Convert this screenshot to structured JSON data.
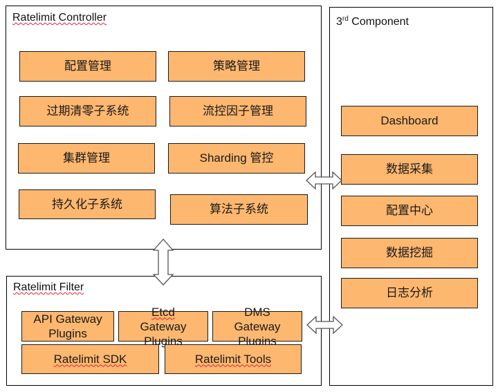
{
  "controller": {
    "title": "Ratelimit Controller",
    "modules": [
      "配置管理",
      "策略管理",
      "过期清零子系统",
      "流控因子管理",
      "集群管理",
      "Sharding 管控",
      "持久化子系统",
      "算法子系统"
    ]
  },
  "third_party": {
    "title_prefix": "3",
    "title_sup": "rd",
    "title_suffix": " Component",
    "modules": [
      "Dashboard",
      "数据采集",
      "配置中心",
      "数据挖掘",
      "日志分析"
    ]
  },
  "filter": {
    "title": "Ratelimit Filter",
    "plugins": [
      [
        "API Gateway",
        "Plugins"
      ],
      [
        "Etcd",
        "Gateway",
        "Plugins"
      ],
      [
        "DMS",
        "Gateway",
        "Plugins"
      ]
    ],
    "tools": [
      "Ratelimit SDK",
      "Ratelimit Tools"
    ]
  },
  "arrows": [
    {
      "name": "controller-filter-arrow",
      "direction": "bidirectional-vertical"
    },
    {
      "name": "controller-third-party-arrow",
      "direction": "bidirectional-horizontal"
    },
    {
      "name": "filter-third-party-arrow",
      "direction": "bidirectional-horizontal"
    }
  ],
  "colors": {
    "module_fill": "#fdb76f",
    "border": "#000000"
  }
}
